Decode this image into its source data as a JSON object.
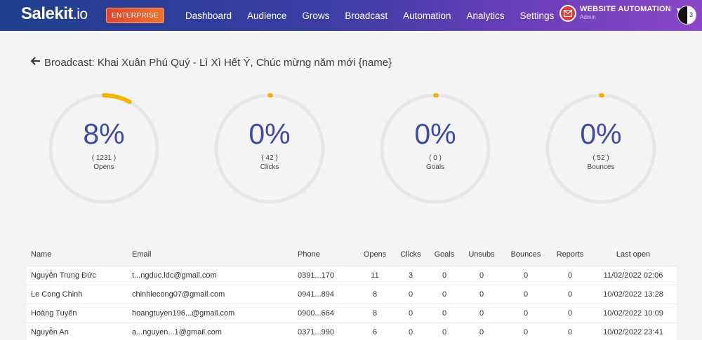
{
  "header": {
    "logo": "Salekit",
    "logo_suffix": ".io",
    "plan_badge": "ENTERPRISE",
    "nav": [
      "Dashboard",
      "Audience",
      "Grows",
      "Broadcast",
      "Automation",
      "Analytics",
      "Settings"
    ],
    "account_name": "WEBSITE AUTOMATION",
    "account_role": "Admin",
    "avatar_badge": "3",
    "colors": {
      "gradient_start": "#1f3f8e",
      "gradient_end": "#8a47c8",
      "badge": "#e0452c"
    }
  },
  "page": {
    "title": "Broadcast: Khai Xuân Phú Quý - Lì Xì Hết Ý, Chúc mừng năm mới {name}",
    "back_icon": "arrow-left-icon"
  },
  "stats": [
    {
      "percent": "8%",
      "count": "( 1231 )",
      "label": "Opens",
      "progress": 0.08
    },
    {
      "percent": "0%",
      "count": "( 42 )",
      "label": "Clicks",
      "progress": 0
    },
    {
      "percent": "0%",
      "count": "( 0 )",
      "label": "Goals",
      "progress": 0
    },
    {
      "percent": "0%",
      "count": "( 52 )",
      "label": "Bounces",
      "progress": 0
    }
  ],
  "stat_colors": {
    "track": "#e6e6e6",
    "progress": "#f5b400",
    "text": "#3f4aa0"
  },
  "table": {
    "columns": [
      "Name",
      "Email",
      "Phone",
      "Opens",
      "Clicks",
      "Goals",
      "Unsubs",
      "Bounces",
      "Reports",
      "Last open"
    ],
    "rows": [
      [
        "Nguyễn Trung Đức",
        "t...ngduc.ldc@gmail.com",
        "0391...170",
        "11",
        "3",
        "0",
        "0",
        "0",
        "0",
        "11/02/2022 02:06"
      ],
      [
        "Le Cong Chinh",
        "chinhlecong07@gmail.com",
        "0941...894",
        "8",
        "0",
        "0",
        "0",
        "0",
        "0",
        "10/02/2022 13:28"
      ],
      [
        "Hoàng Tuyến",
        "hoangtuyen196...@gmail.com",
        "0900...664",
        "8",
        "0",
        "0",
        "0",
        "0",
        "0",
        "10/02/2022 10:09"
      ],
      [
        "Nguyễn An",
        "a...nguyen...1@gmail.com",
        "0371...990",
        "6",
        "0",
        "0",
        "0",
        "0",
        "0",
        "10/02/2022 23:41"
      ]
    ]
  }
}
